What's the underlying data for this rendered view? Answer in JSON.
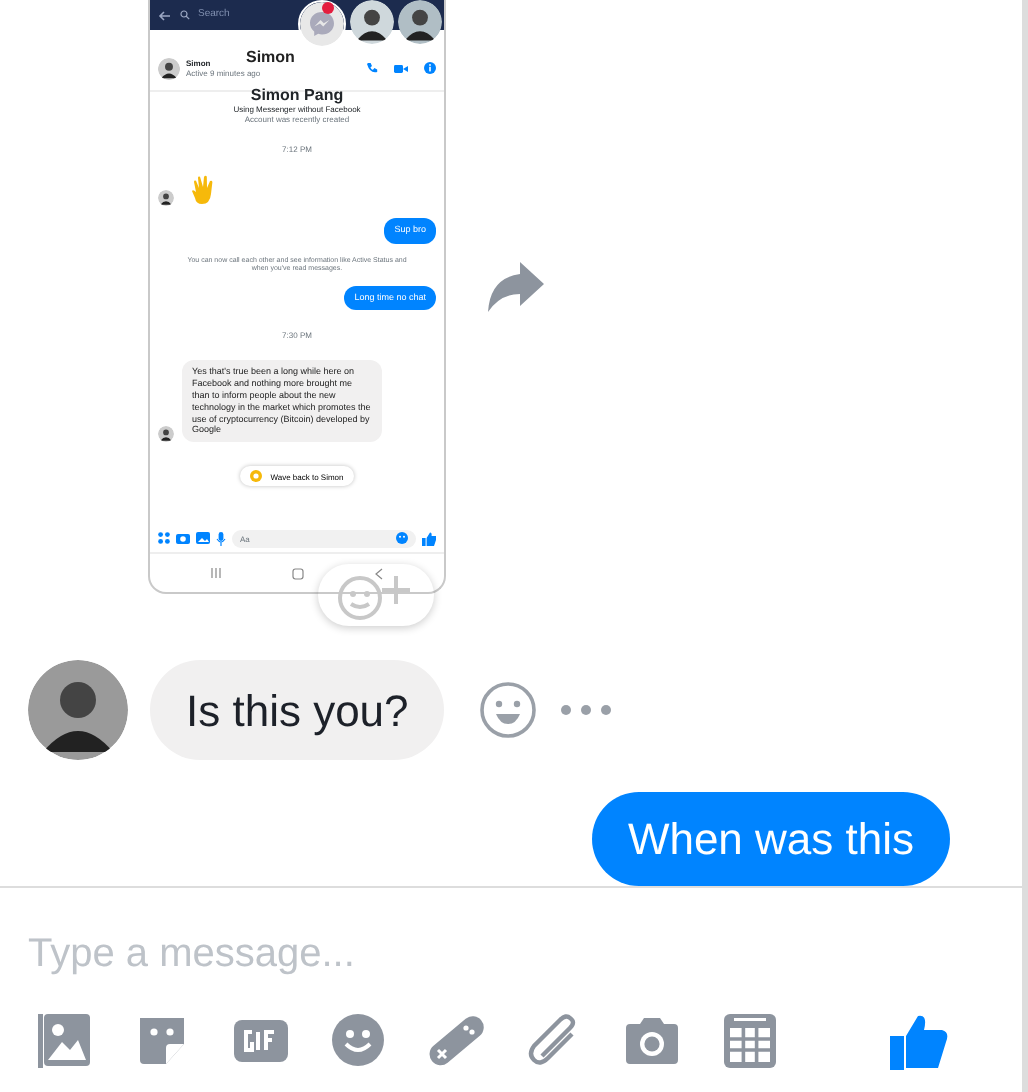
{
  "shared_screenshot": {
    "search_placeholder": "Search",
    "header_title": "Simon",
    "contact": {
      "name": "Simon",
      "status": "Active 9 minutes ago"
    },
    "intro": {
      "name": "Simon Pang",
      "line_1": "Using Messenger without Facebook",
      "line_2": "Account was recently created"
    },
    "messages": [
      {
        "kind": "time",
        "text": "7:12 PM"
      },
      {
        "kind": "wave"
      },
      {
        "kind": "outgoing",
        "text": "Sup bro"
      },
      {
        "kind": "notice",
        "text": "You can now call each other and see information like Active Status and when you've read messages."
      },
      {
        "kind": "outgoing",
        "text": "Long time no chat"
      },
      {
        "kind": "time",
        "text": "7:30 PM"
      },
      {
        "kind": "incoming",
        "text": "Yes that's true been a long while here on Facebook and nothing more brought me than to inform  people about the new technology in the market which promotes the use of cryptocurrency (Bitcoin) developed by Google"
      }
    ],
    "wave_button": "Wave back to Simon",
    "composer_placeholder": "Aa"
  },
  "conversation": [
    {
      "kind": "incoming",
      "text": "Is this you?"
    },
    {
      "kind": "outgoing",
      "text": "When was this"
    }
  ],
  "composer": {
    "placeholder": "Type a message..."
  }
}
